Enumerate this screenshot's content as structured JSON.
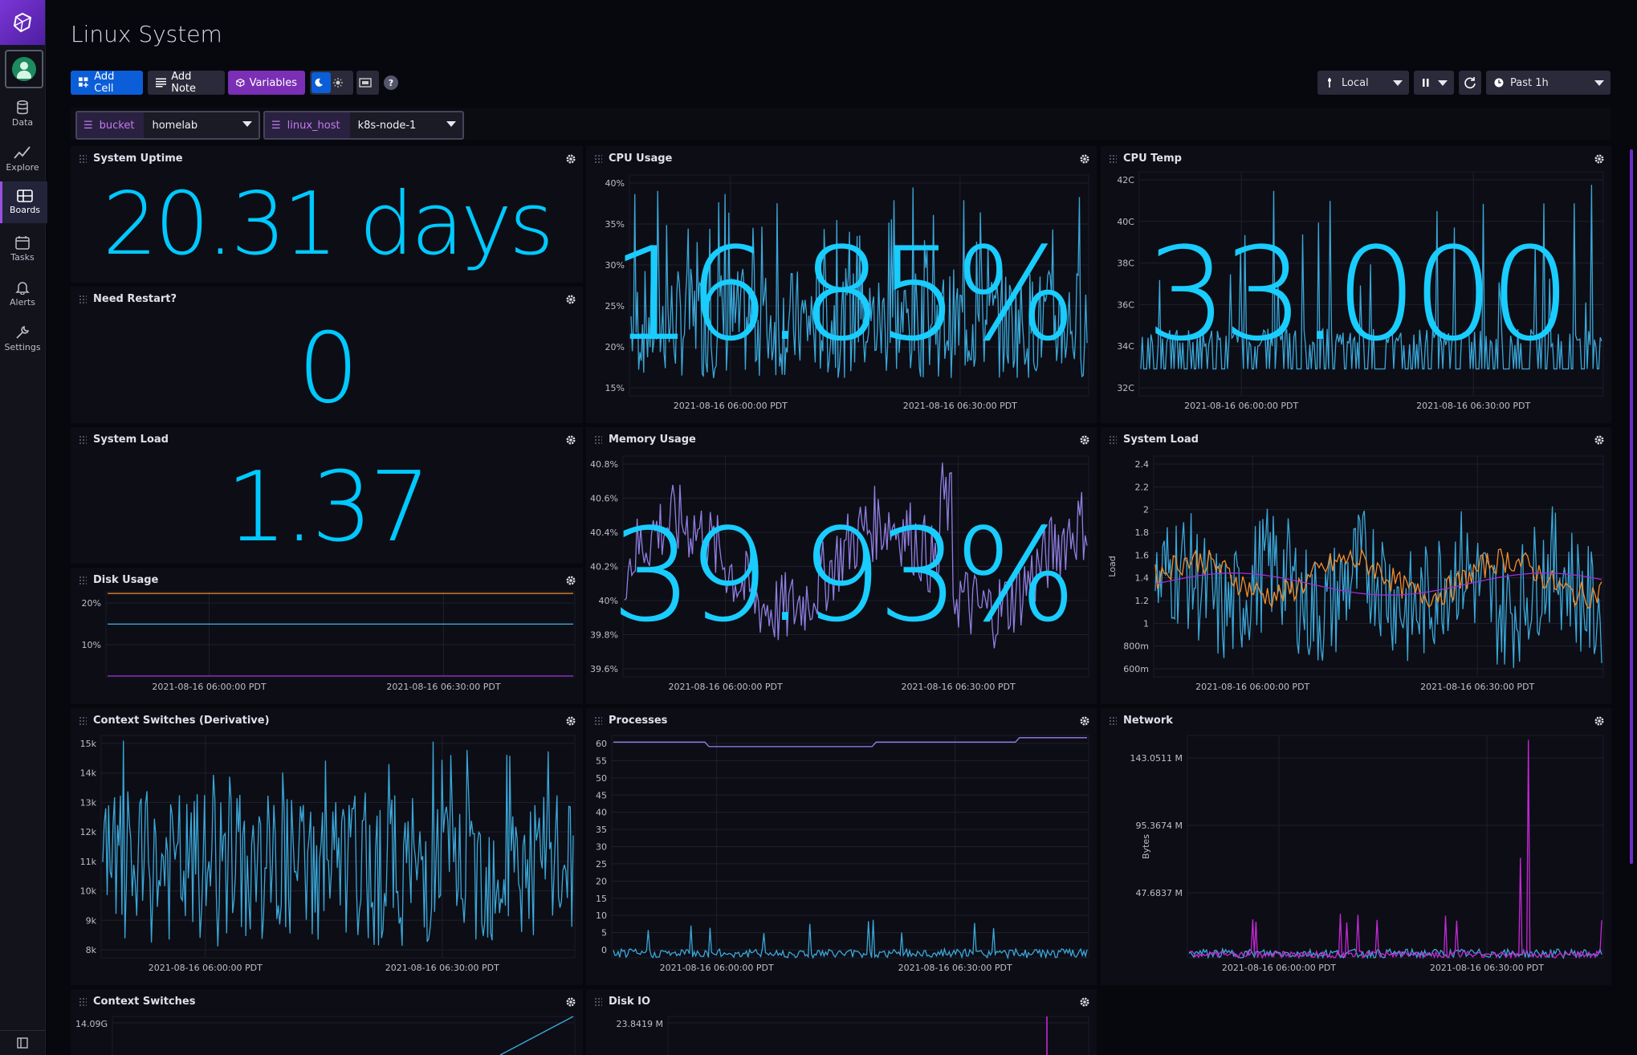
{
  "app": {
    "page_title": "Linux System"
  },
  "sidebar": {
    "items": [
      {
        "label": "Data",
        "icon": "database-icon"
      },
      {
        "label": "Explore",
        "icon": "graph-icon"
      },
      {
        "label": "Boards",
        "icon": "dashboard-icon",
        "active": true
      },
      {
        "label": "Tasks",
        "icon": "calendar-icon"
      },
      {
        "label": "Alerts",
        "icon": "bell-icon"
      },
      {
        "label": "Settings",
        "icon": "wrench-icon"
      }
    ]
  },
  "toolbar": {
    "add_cell": "Add Cell",
    "add_note": "Add Note",
    "variables": "Variables",
    "timezone": "Local",
    "time_range": "Past 1h"
  },
  "variables": [
    {
      "key": "bucket",
      "value": "homelab"
    },
    {
      "key": "linux_host",
      "value": "k8s-node-1"
    }
  ],
  "colors": {
    "accent": "#00c9ff",
    "primary_button": "#0b5ed7",
    "variables_button": "#7a2fb5",
    "series_blue": "#3aa8d8",
    "series_orange": "#f28e2b",
    "series_purple": "#9b2fd6"
  },
  "cells": {
    "uptime": {
      "title": "System Uptime",
      "value": "20.31 days"
    },
    "restart": {
      "title": "Need Restart?",
      "value": "0"
    },
    "load_stat": {
      "title": "System Load",
      "value": "1.37"
    },
    "cpu": {
      "title": "CPU Usage",
      "value": "16.85%",
      "y_ticks": [
        "40%",
        "35%",
        "30%",
        "25%",
        "20%",
        "15%"
      ],
      "x_ticks": [
        "2021-08-16 06:00:00 PDT",
        "2021-08-16 06:30:00 PDT"
      ]
    },
    "cpu_temp": {
      "title": "CPU Temp",
      "value": "33.000",
      "y_ticks": [
        "42C",
        "40C",
        "38C",
        "36C",
        "34C",
        "32C"
      ],
      "x_ticks": [
        "2021-08-16 06:00:00 PDT",
        "2021-08-16 06:30:00 PDT"
      ]
    },
    "memory": {
      "title": "Memory Usage",
      "value": "39.93%",
      "y_ticks": [
        "40.8%",
        "40.6%",
        "40.4%",
        "40.2%",
        "40%",
        "39.8%",
        "39.6%"
      ],
      "x_ticks": [
        "2021-08-16 06:00:00 PDT",
        "2021-08-16 06:30:00 PDT"
      ]
    },
    "load_graph": {
      "title": "System Load",
      "ylabel": "Load",
      "y_ticks": [
        "2.4",
        "2.2",
        "2",
        "1.8",
        "1.6",
        "1.4",
        "1.2",
        "1",
        "800m",
        "600m"
      ],
      "x_ticks": [
        "2021-08-16 06:00:00 PDT",
        "2021-08-16 06:30:00 PDT"
      ]
    },
    "disk": {
      "title": "Disk Usage",
      "y_ticks": [
        "20%",
        "10%"
      ],
      "x_ticks": [
        "2021-08-16 06:00:00 PDT",
        "2021-08-16 06:30:00 PDT"
      ]
    },
    "ctx_deriv": {
      "title": "Context Switches (Derivative)",
      "y_ticks": [
        "15k",
        "14k",
        "13k",
        "12k",
        "11k",
        "10k",
        "9k",
        "8k"
      ],
      "x_ticks": [
        "2021-08-16 06:00:00 PDT",
        "2021-08-16 06:30:00 PDT"
      ]
    },
    "processes": {
      "title": "Processes",
      "y_ticks": [
        "60",
        "55",
        "50",
        "45",
        "40",
        "35",
        "30",
        "25",
        "20",
        "15",
        "10",
        "5",
        "0"
      ],
      "x_ticks": [
        "2021-08-16 06:00:00 PDT",
        "2021-08-16 06:30:00 PDT"
      ]
    },
    "network": {
      "title": "Network",
      "ylabel": "Bytes",
      "y_ticks": [
        "143.0511 M",
        "95.3674 M",
        "47.6837 M"
      ],
      "x_ticks": [
        "2021-08-16 06:00:00 PDT",
        "2021-08-16 06:30:00 PDT"
      ]
    },
    "ctx": {
      "title": "Context Switches",
      "y_ticks": [
        "14.09G"
      ]
    },
    "diskio": {
      "title": "Disk IO",
      "y_ticks": [
        "23.8419 M"
      ]
    }
  }
}
